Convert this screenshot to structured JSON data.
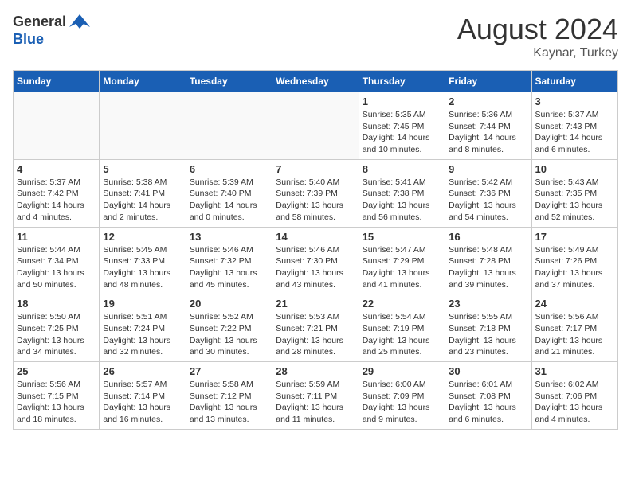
{
  "header": {
    "logo_general": "General",
    "logo_blue": "Blue",
    "month": "August 2024",
    "location": "Kaynar, Turkey"
  },
  "weekdays": [
    "Sunday",
    "Monday",
    "Tuesday",
    "Wednesday",
    "Thursday",
    "Friday",
    "Saturday"
  ],
  "weeks": [
    [
      {
        "day": "",
        "info": ""
      },
      {
        "day": "",
        "info": ""
      },
      {
        "day": "",
        "info": ""
      },
      {
        "day": "",
        "info": ""
      },
      {
        "day": "1",
        "info": "Sunrise: 5:35 AM\nSunset: 7:45 PM\nDaylight: 14 hours\nand 10 minutes."
      },
      {
        "day": "2",
        "info": "Sunrise: 5:36 AM\nSunset: 7:44 PM\nDaylight: 14 hours\nand 8 minutes."
      },
      {
        "day": "3",
        "info": "Sunrise: 5:37 AM\nSunset: 7:43 PM\nDaylight: 14 hours\nand 6 minutes."
      }
    ],
    [
      {
        "day": "4",
        "info": "Sunrise: 5:37 AM\nSunset: 7:42 PM\nDaylight: 14 hours\nand 4 minutes."
      },
      {
        "day": "5",
        "info": "Sunrise: 5:38 AM\nSunset: 7:41 PM\nDaylight: 14 hours\nand 2 minutes."
      },
      {
        "day": "6",
        "info": "Sunrise: 5:39 AM\nSunset: 7:40 PM\nDaylight: 14 hours\nand 0 minutes."
      },
      {
        "day": "7",
        "info": "Sunrise: 5:40 AM\nSunset: 7:39 PM\nDaylight: 13 hours\nand 58 minutes."
      },
      {
        "day": "8",
        "info": "Sunrise: 5:41 AM\nSunset: 7:38 PM\nDaylight: 13 hours\nand 56 minutes."
      },
      {
        "day": "9",
        "info": "Sunrise: 5:42 AM\nSunset: 7:36 PM\nDaylight: 13 hours\nand 54 minutes."
      },
      {
        "day": "10",
        "info": "Sunrise: 5:43 AM\nSunset: 7:35 PM\nDaylight: 13 hours\nand 52 minutes."
      }
    ],
    [
      {
        "day": "11",
        "info": "Sunrise: 5:44 AM\nSunset: 7:34 PM\nDaylight: 13 hours\nand 50 minutes."
      },
      {
        "day": "12",
        "info": "Sunrise: 5:45 AM\nSunset: 7:33 PM\nDaylight: 13 hours\nand 48 minutes."
      },
      {
        "day": "13",
        "info": "Sunrise: 5:46 AM\nSunset: 7:32 PM\nDaylight: 13 hours\nand 45 minutes."
      },
      {
        "day": "14",
        "info": "Sunrise: 5:46 AM\nSunset: 7:30 PM\nDaylight: 13 hours\nand 43 minutes."
      },
      {
        "day": "15",
        "info": "Sunrise: 5:47 AM\nSunset: 7:29 PM\nDaylight: 13 hours\nand 41 minutes."
      },
      {
        "day": "16",
        "info": "Sunrise: 5:48 AM\nSunset: 7:28 PM\nDaylight: 13 hours\nand 39 minutes."
      },
      {
        "day": "17",
        "info": "Sunrise: 5:49 AM\nSunset: 7:26 PM\nDaylight: 13 hours\nand 37 minutes."
      }
    ],
    [
      {
        "day": "18",
        "info": "Sunrise: 5:50 AM\nSunset: 7:25 PM\nDaylight: 13 hours\nand 34 minutes."
      },
      {
        "day": "19",
        "info": "Sunrise: 5:51 AM\nSunset: 7:24 PM\nDaylight: 13 hours\nand 32 minutes."
      },
      {
        "day": "20",
        "info": "Sunrise: 5:52 AM\nSunset: 7:22 PM\nDaylight: 13 hours\nand 30 minutes."
      },
      {
        "day": "21",
        "info": "Sunrise: 5:53 AM\nSunset: 7:21 PM\nDaylight: 13 hours\nand 28 minutes."
      },
      {
        "day": "22",
        "info": "Sunrise: 5:54 AM\nSunset: 7:19 PM\nDaylight: 13 hours\nand 25 minutes."
      },
      {
        "day": "23",
        "info": "Sunrise: 5:55 AM\nSunset: 7:18 PM\nDaylight: 13 hours\nand 23 minutes."
      },
      {
        "day": "24",
        "info": "Sunrise: 5:56 AM\nSunset: 7:17 PM\nDaylight: 13 hours\nand 21 minutes."
      }
    ],
    [
      {
        "day": "25",
        "info": "Sunrise: 5:56 AM\nSunset: 7:15 PM\nDaylight: 13 hours\nand 18 minutes."
      },
      {
        "day": "26",
        "info": "Sunrise: 5:57 AM\nSunset: 7:14 PM\nDaylight: 13 hours\nand 16 minutes."
      },
      {
        "day": "27",
        "info": "Sunrise: 5:58 AM\nSunset: 7:12 PM\nDaylight: 13 hours\nand 13 minutes."
      },
      {
        "day": "28",
        "info": "Sunrise: 5:59 AM\nSunset: 7:11 PM\nDaylight: 13 hours\nand 11 minutes."
      },
      {
        "day": "29",
        "info": "Sunrise: 6:00 AM\nSunset: 7:09 PM\nDaylight: 13 hours\nand 9 minutes."
      },
      {
        "day": "30",
        "info": "Sunrise: 6:01 AM\nSunset: 7:08 PM\nDaylight: 13 hours\nand 6 minutes."
      },
      {
        "day": "31",
        "info": "Sunrise: 6:02 AM\nSunset: 7:06 PM\nDaylight: 13 hours\nand 4 minutes."
      }
    ]
  ]
}
